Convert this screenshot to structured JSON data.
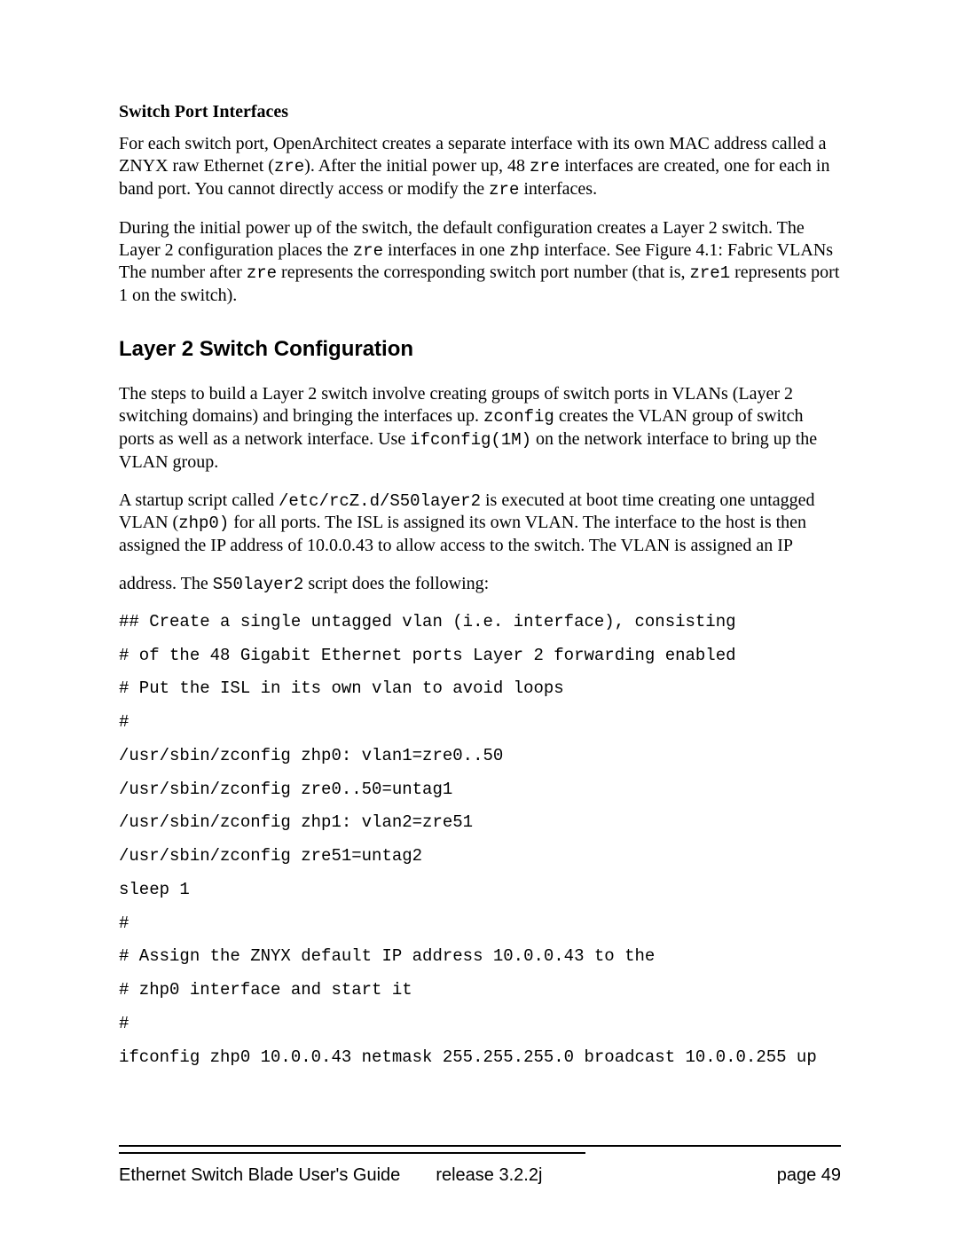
{
  "section1_title": "Switch Port Interfaces",
  "p1_a": "For each switch port, OpenArchitect creates a separate interface with its own MAC address called a ZNYX raw Ethernet (",
  "p1_b": "). After the initial power up, 48 ",
  "p1_c": " interfaces are created, one for each in band port. You cannot directly access or modify the ",
  "p1_d": " interfaces.",
  "p2_a": "During the initial power up of the switch, the default configuration creates a Layer 2 switch. The Layer 2 configuration places the ",
  "p2_b": " interfaces in one ",
  "p2_c": " interface. See Figure 4.1: Fabric VLANs The number after ",
  "p2_d": " represents the corresponding switch port number (that is, ",
  "p2_e": " represents port 1 on the switch).",
  "h2": "Layer 2 Switch Configuration",
  "p3_a": "The steps to build a Layer 2 switch involve creating groups of switch ports in VLANs (Layer 2 switching domains) and bringing the interfaces up. ",
  "p3_b": " creates the VLAN group of switch ports as well as a network interface. Use ",
  "p3_c": " on the network interface to bring up the VLAN group.",
  "p4_a": "A startup script called ",
  "p4_b": " is executed at boot time creating one untagged VLAN (",
  "p4_c": " for all ports.  The ISL is assigned its own VLAN. The interface to the host is then assigned the IP address of 10.0.0.43 to allow access to the switch. The VLAN is assigned an IP",
  "p5_a": "address. The ",
  "p5_b": " script does the following:",
  "mono_zre": "zre",
  "mono_zhp": "zhp",
  "mono_zre1": "zre1",
  "mono_zconfig": "zconfig",
  "mono_ifconfig": "ifconfig(1M)",
  "mono_path": "/etc/rcZ.d/S50layer2",
  "mono_zhp0": "zhp0)",
  "mono_s50": "S50layer2",
  "code": [
    "## Create a single untagged vlan (i.e. interface), consisting",
    "# of the 48 Gigabit Ethernet ports Layer 2 forwarding enabled",
    "# Put the ISL in its own vlan to avoid loops",
    "#",
    "/usr/sbin/zconfig zhp0: vlan1=zre0..50",
    "/usr/sbin/zconfig zre0..50=untag1",
    "/usr/sbin/zconfig zhp1: vlan2=zre51",
    "/usr/sbin/zconfig zre51=untag2",
    "sleep 1",
    "#",
    "# Assign the ZNYX default IP address 10.0.0.43 to the",
    "# zhp0 interface and start it",
    "#",
    "ifconfig zhp0 10.0.0.43 netmask 255.255.255.0 broadcast 10.0.0.255 up"
  ],
  "footer_title": "Ethernet Switch Blade User's Guide",
  "footer_release": "release  3.2.2j",
  "footer_page": "page 49"
}
